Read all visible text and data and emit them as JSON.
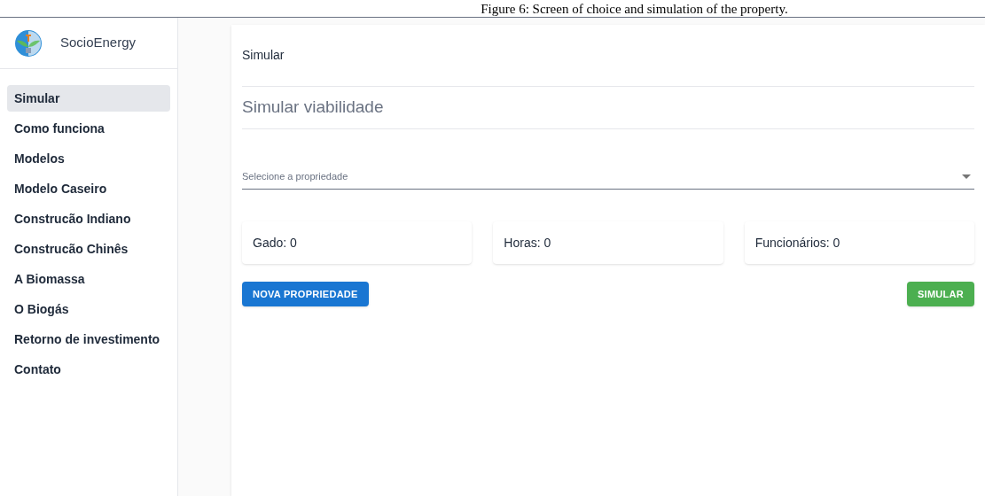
{
  "caption": "Figure 6: Screen of choice and simulation of the property.",
  "app": {
    "name": "SocioEnergy"
  },
  "sidebar": {
    "items": [
      {
        "label": "Simular",
        "selected": true
      },
      {
        "label": "Como funciona",
        "selected": false
      },
      {
        "label": "Modelos",
        "selected": false
      },
      {
        "label": "Modelo Caseiro",
        "selected": false
      },
      {
        "label": "Construcão Indiano",
        "selected": false
      },
      {
        "label": "Construcão Chinês",
        "selected": false
      },
      {
        "label": "A Biomassa",
        "selected": false
      },
      {
        "label": "O Biogás",
        "selected": false
      },
      {
        "label": "Retorno de investimento",
        "selected": false
      },
      {
        "label": "Contato",
        "selected": false
      }
    ]
  },
  "card": {
    "header": "Simular",
    "title": "Simular viabilidade",
    "select": {
      "placeholder": "Selecione a propriedade"
    },
    "stats": [
      "Gado: 0",
      "Horas: 0",
      "Funcionários: 0"
    ],
    "buttons": {
      "new": "NOVA PROPRIEDADE",
      "simulate": "SIMULAR"
    }
  }
}
